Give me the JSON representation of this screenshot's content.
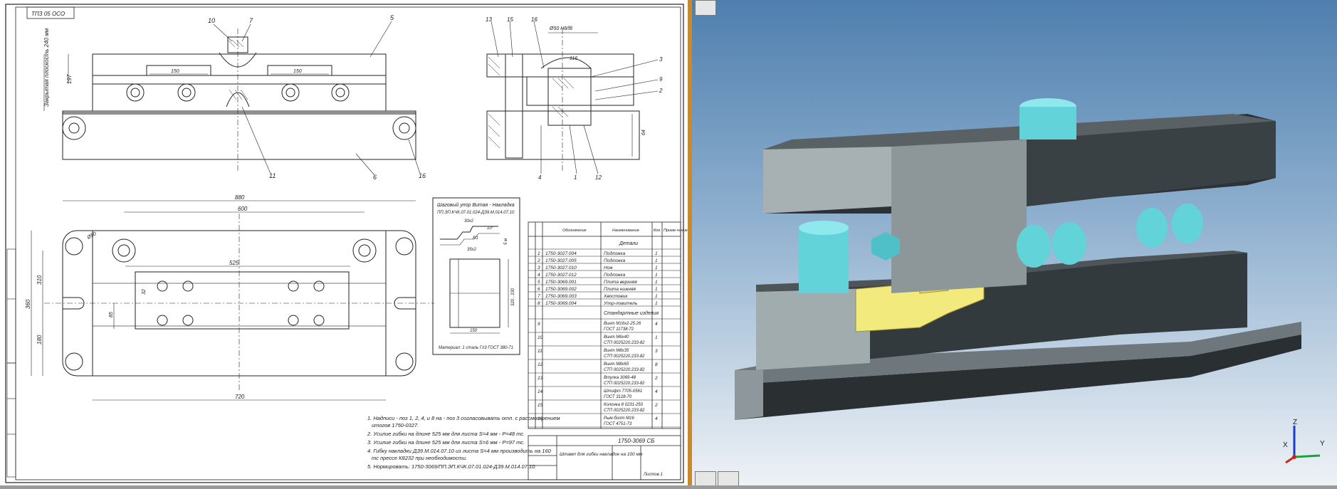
{
  "drawing": {
    "code_stamp": "ТПЗ 05 ОСО",
    "dims": {
      "d_880": "880",
      "d_600": "600",
      "d_525": "525",
      "d_720": "720",
      "d_360": "360",
      "d_310": "310",
      "d_180": "180",
      "d_85": "85",
      "d_32a": "32",
      "d_150": "150",
      "d_50": "Ø50",
      "d_197": "197",
      "d_vert_left": "Закрытая плоскость 240 мм",
      "d_top_right": "Ø50 H8/f8",
      "d_116": "116",
      "d_64": "64"
    },
    "callouts": [
      "10",
      "7",
      "5",
      "6",
      "11",
      "16",
      "13",
      "15",
      "16",
      "3",
      "9",
      "2",
      "4",
      "1",
      "12",
      "8"
    ],
    "profile_box": {
      "title_line1": "Шаговый упор Витая - Накладка",
      "title_line2": "ПП.ЭП.КЧК.07.01.024-ДЗ9.М.014.07.10",
      "dim_a": "30x2",
      "dim_b": "10°",
      "dim_c": "R1",
      "dim_d": "35x2",
      "dim_e": "5 м",
      "dim_f": "320...330",
      "dim_g": "150",
      "material": "Материал: 1 сталь Гл3 ГОСТ 380-71"
    },
    "spec_table": {
      "headers": [
        "",
        "",
        "Обозначение",
        "Наименование",
        "Кол.",
        "Приме-чание"
      ],
      "section_details": "Детали",
      "rows": [
        {
          "pos": "1",
          "code": "1750-3027.004",
          "name": "Подложка",
          "qty": "1"
        },
        {
          "pos": "2",
          "code": "1750-3027.005",
          "name": "Подложка",
          "qty": "1"
        },
        {
          "pos": "3",
          "code": "1750-3027.010",
          "name": "Нож",
          "qty": "1"
        },
        {
          "pos": "4",
          "code": "1750-3027.012",
          "name": "Подложка",
          "qty": "1"
        },
        {
          "pos": "5",
          "code": "1750-3069.001",
          "name": "Плита верхняя",
          "qty": "1"
        },
        {
          "pos": "6",
          "code": "1750-3069.002",
          "name": "Плита нижняя",
          "qty": "1"
        },
        {
          "pos": "7",
          "code": "1750-3069.003",
          "name": "Хвостовик",
          "qty": "1"
        },
        {
          "pos": "8",
          "code": "1750-3069.004",
          "name": "Упор-ловитель",
          "qty": "1"
        }
      ],
      "section_std": "Стандартные изделия",
      "std_rows": [
        {
          "pos": "9",
          "name": "Винт М16x2-25.26 ГОСТ 11738-72",
          "qty": "4"
        },
        {
          "pos": "10",
          "name": "Винт М6x40 СТП 0025220.233-82",
          "qty": "1"
        },
        {
          "pos": "11",
          "name": "Винт М8x35 СТП 0025220.233-82",
          "qty": "3"
        },
        {
          "pos": "12",
          "name": "Винт М8x65 СТП 0025220.233-82",
          "qty": "8"
        },
        {
          "pos": "13",
          "name": "Втулка 3069-48 СТП 0025220.233-82",
          "qty": "2"
        },
        {
          "pos": "14",
          "name": "Штифт 7705-0561 ГОСТ 3128-70",
          "qty": "4"
        },
        {
          "pos": "15",
          "name": "Колонка 8 0231-250 СТП 0025220.233-82",
          "qty": "2"
        },
        {
          "pos": "16",
          "name": "Рым-болт М16 ГОСТ 4751-73",
          "qty": "4"
        }
      ]
    },
    "notes": [
      "1. Надписи - поз 1, 2, 4, и 8 на - поз 3 согласовывать отп. с рассмотрением",
      "итогов 1750-0327.",
      "2. Усилие гибки на длине 525 мм для листа S=4 мм - P=48 тс.",
      "3. Усилие гибки на длине 525 мм для листа S=6 мм - P=97 тс.",
      "4. Гибку накладки ДЗ9.М.014.07.10 из листа S=4 мм производить на 160",
      "тс прессе К8232 при необходимости.",
      "5. Нормировать: 1750-3069/ПП.ЭП.КЧК.07.01.024-ДЗ9.М.014.07.10."
    ],
    "title_block": {
      "code": "1750-3069 СБ",
      "name": "Штамп для гибки накладок на 100 мм",
      "sheet": "Листов 1"
    }
  },
  "viewport": {
    "axes": {
      "x": "X",
      "y": "Y",
      "z": "Z"
    },
    "colors": {
      "body": "#3c4346",
      "bushing": "#63d3da",
      "part": "#f3ea7d"
    }
  }
}
